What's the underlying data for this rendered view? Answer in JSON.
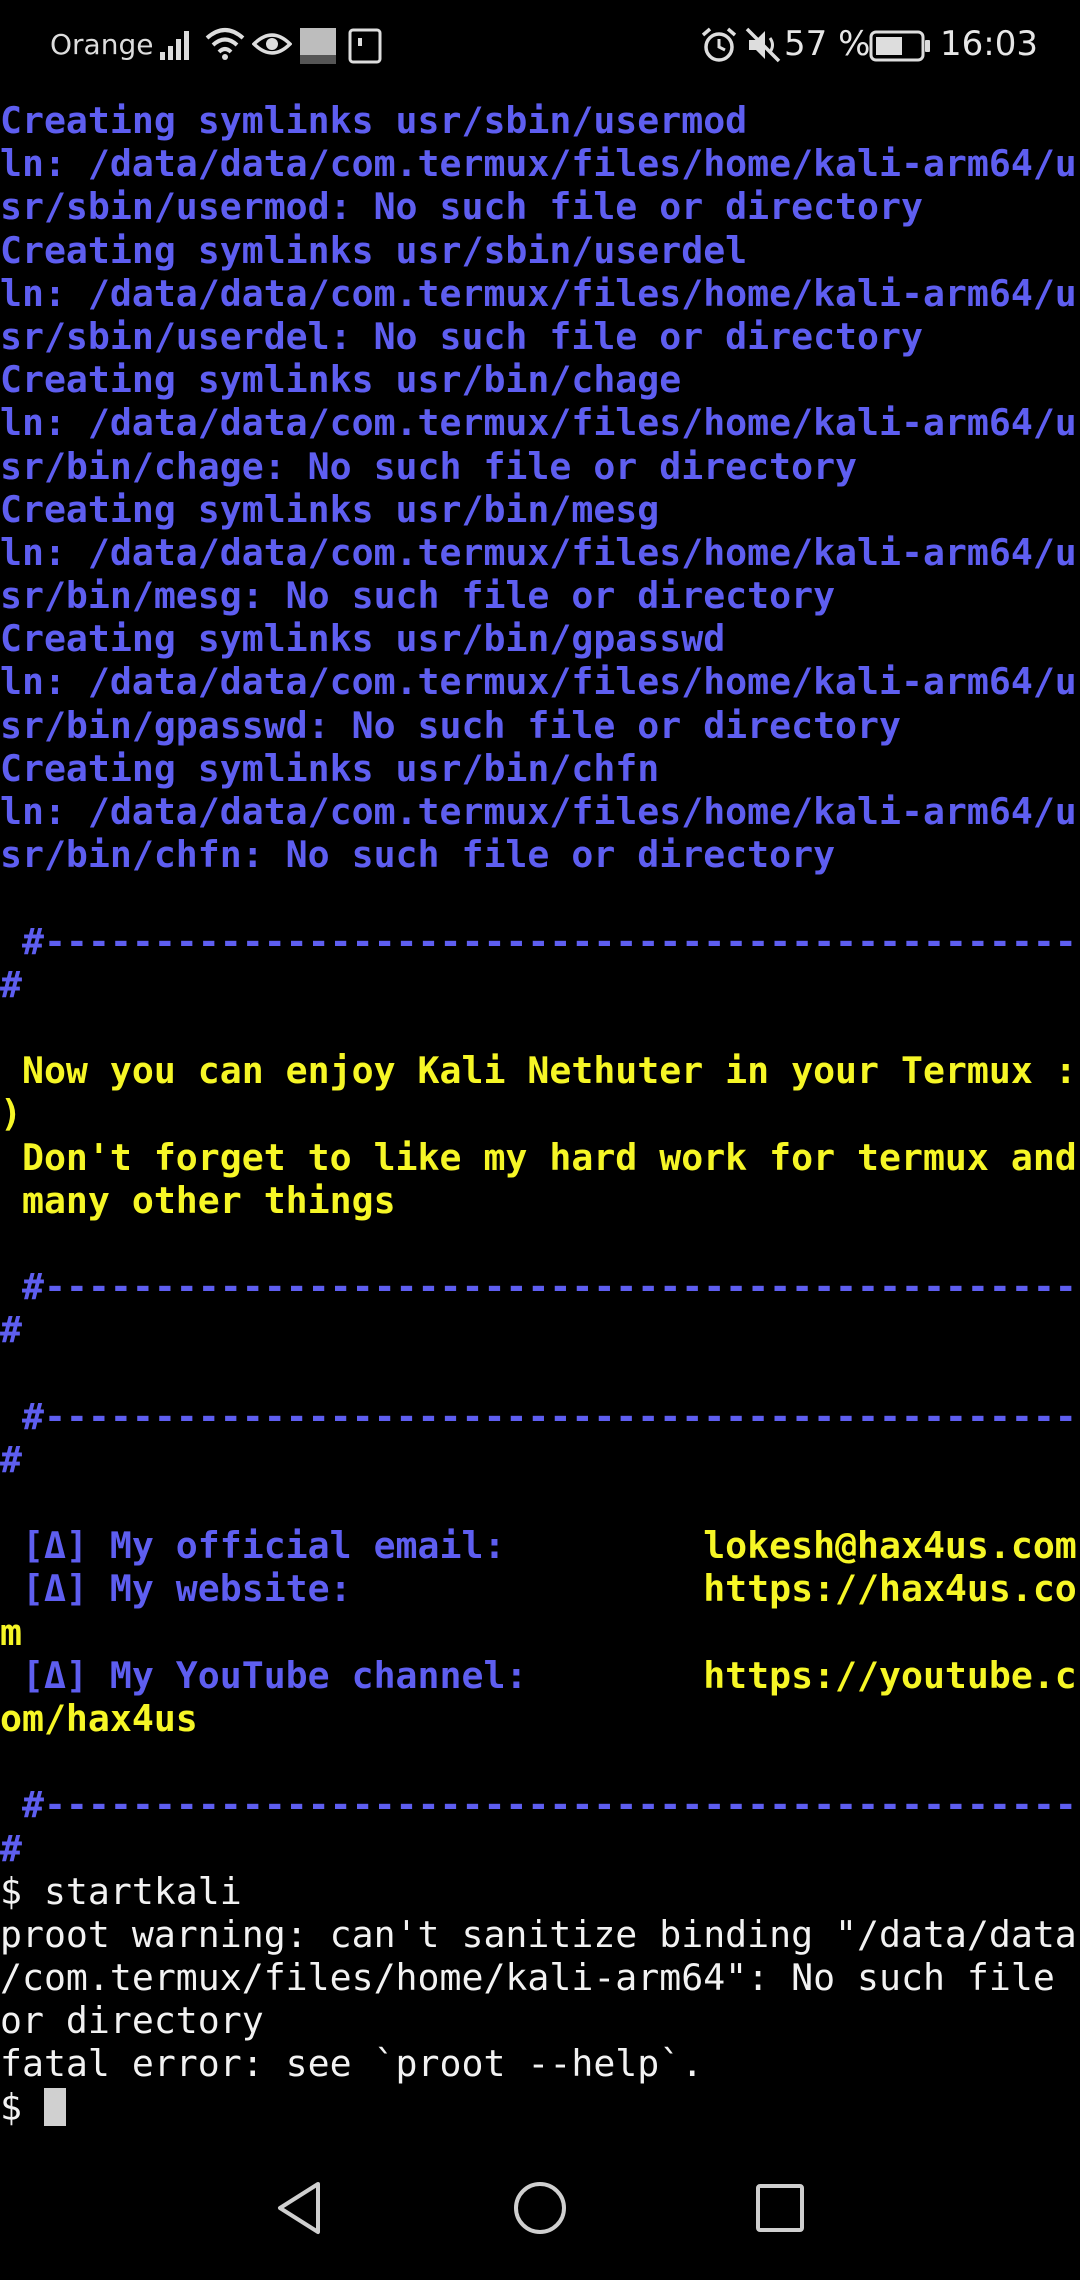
{
  "status_bar": {
    "carrier": "Orange",
    "battery": "57 %",
    "time": "16:03",
    "icons": [
      "signal-icon",
      "wifi-icon",
      "eye-icon",
      "orange-app-icon",
      "sim-icon",
      "alarm-icon",
      "mute-icon",
      "battery-icon"
    ]
  },
  "terminal": {
    "colors": {
      "background": "#000000",
      "blue": "#5e5ef0",
      "yellow": "#f6f626",
      "white": "#f2f2f2"
    },
    "lines": [
      {
        "text": "Creating symlinks usr/sbin/usermod",
        "color": "blue"
      },
      {
        "text": "ln: /data/data/com.termux/files/home/kali-arm64/u",
        "color": "blue"
      },
      {
        "text": "sr/sbin/usermod: No such file or directory",
        "color": "blue"
      },
      {
        "text": "Creating symlinks usr/sbin/userdel",
        "color": "blue"
      },
      {
        "text": "ln: /data/data/com.termux/files/home/kali-arm64/u",
        "color": "blue"
      },
      {
        "text": "sr/sbin/userdel: No such file or directory",
        "color": "blue"
      },
      {
        "text": "Creating symlinks usr/bin/chage",
        "color": "blue"
      },
      {
        "text": "ln: /data/data/com.termux/files/home/kali-arm64/u",
        "color": "blue"
      },
      {
        "text": "sr/bin/chage: No such file or directory",
        "color": "blue"
      },
      {
        "text": "Creating symlinks usr/bin/mesg",
        "color": "blue"
      },
      {
        "text": "ln: /data/data/com.termux/files/home/kali-arm64/u",
        "color": "blue"
      },
      {
        "text": "sr/bin/mesg: No such file or directory",
        "color": "blue"
      },
      {
        "text": "Creating symlinks usr/bin/gpasswd",
        "color": "blue"
      },
      {
        "text": "ln: /data/data/com.termux/files/home/kali-arm64/u",
        "color": "blue"
      },
      {
        "text": "sr/bin/gpasswd: No such file or directory",
        "color": "blue"
      },
      {
        "text": "Creating symlinks usr/bin/chfn",
        "color": "blue"
      },
      {
        "text": "ln: /data/data/com.termux/files/home/kali-arm64/u",
        "color": "blue"
      },
      {
        "text": "sr/bin/chfn: No such file or directory",
        "color": "blue"
      },
      {
        "text": "",
        "color": "blue"
      },
      {
        "text": " #-------------------------------------------------",
        "color": "blue"
      },
      {
        "text": "#",
        "color": "blue"
      },
      {
        "text": "",
        "color": "blue"
      },
      {
        "text": " Now you can enjoy Kali Nethuter in your Termux :",
        "color": "yellow"
      },
      {
        "text": ")",
        "color": "yellow"
      },
      {
        "text": " Don't forget to like my hard work for termux and",
        "color": "yellow"
      },
      {
        "text": " many other things",
        "color": "yellow"
      },
      {
        "text": "",
        "color": "blue"
      },
      {
        "text": " #-------------------------------------------------",
        "color": "blue"
      },
      {
        "text": "#",
        "color": "blue"
      },
      {
        "text": "",
        "color": "blue"
      },
      {
        "text": " #-------------------------------------------------",
        "color": "blue"
      },
      {
        "text": "#",
        "color": "blue"
      },
      {
        "text": "",
        "color": "blue"
      },
      {
        "segments": [
          {
            "text": " [Δ] My official email:         ",
            "color": "blue"
          },
          {
            "text": "lokesh@hax4us.com",
            "color": "yellow"
          }
        ]
      },
      {
        "segments": [
          {
            "text": " [Δ] My website:                ",
            "color": "blue"
          },
          {
            "text": "https://hax4us.co",
            "color": "yellow"
          }
        ]
      },
      {
        "text": "m",
        "color": "yellow"
      },
      {
        "segments": [
          {
            "text": " [Δ] My YouTube channel:        ",
            "color": "blue"
          },
          {
            "text": "https://youtube.c",
            "color": "yellow"
          }
        ]
      },
      {
        "text": "om/hax4us",
        "color": "yellow"
      },
      {
        "text": "",
        "color": "blue"
      },
      {
        "text": " #-------------------------------------------------",
        "color": "blue"
      },
      {
        "text": "#",
        "color": "blue"
      },
      {
        "text": "$ startkali",
        "color": "white"
      },
      {
        "text": "proot warning: can't sanitize binding \"/data/data",
        "color": "white"
      },
      {
        "text": "/com.termux/files/home/kali-arm64\": No such file",
        "color": "white"
      },
      {
        "text": "or directory",
        "color": "white"
      },
      {
        "text": "fatal error: see `proot --help`.",
        "color": "white"
      }
    ],
    "prompt": "$ "
  },
  "nav_bar": {
    "buttons": [
      "back-icon",
      "home-icon",
      "recents-icon"
    ]
  }
}
